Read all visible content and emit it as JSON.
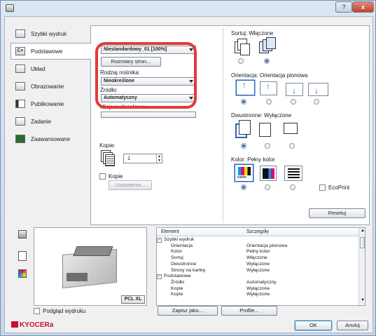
{
  "titlebar": {
    "help": "?",
    "close": "x"
  },
  "nav": [
    {
      "label": "Szybki wydruk",
      "icon": "quick-print-icon"
    },
    {
      "label": "Podstawowe",
      "icon": "basic-icon",
      "glyph": "C+"
    },
    {
      "label": "Układ",
      "icon": "layout-icon"
    },
    {
      "label": "Obrazowanie",
      "icon": "imaging-icon"
    },
    {
      "label": "Publikowanie",
      "icon": "publishing-icon"
    },
    {
      "label": "Zadanie",
      "icon": "job-icon"
    },
    {
      "label": "Zaawansowane",
      "icon": "advanced-icon"
    }
  ],
  "basic": {
    "page_size_value": "Niestandardowy_01 [100%]",
    "page_sizes_button": "Rozmiary stron...",
    "media_type_label": "Rodzaj nośnika:",
    "media_type_value": "Nieokreślone",
    "source_label": "Źródło:",
    "source_value": "Automatyczny",
    "destination_label": "Miejsce docelowe:",
    "copies_label": "Kopie:",
    "copies_value": "1",
    "collate_label": "Kopie",
    "settings_button": "Ustawienia..."
  },
  "right": {
    "collate_label": "Sortuj: Włączone",
    "orientation_label": "Orientacja: Orientacja pionowa",
    "duplex_label": "Dwustronne: Wyłączone",
    "color_label": "Kolor: Pełny kolor",
    "cmyk_text": "CMYK",
    "ecoprint_label": "EcoPrint",
    "reset_button": "Resetuj"
  },
  "preview": {
    "pcl_badge": "PCL XL",
    "preview_checkbox": "Podgląd wydruku"
  },
  "summary": {
    "col_element": "Element",
    "col_details": "Szczegóły",
    "rows": [
      {
        "name": "Szybki wydruk",
        "value": "",
        "group": true
      },
      {
        "name": "Orientacja",
        "value": "Orientacja pionowa",
        "group": false
      },
      {
        "name": "Kolor",
        "value": "Pełny kolor",
        "group": false
      },
      {
        "name": "Sortuj",
        "value": "Włączone",
        "group": false
      },
      {
        "name": "Dwustronne",
        "value": "Wyłączone",
        "group": false
      },
      {
        "name": "Strony na kartkę",
        "value": "Wyłączone",
        "group": false
      },
      {
        "name": "Podstawowe",
        "value": "",
        "group": true
      },
      {
        "name": "Źródło",
        "value": "Automatyczny",
        "group": false
      },
      {
        "name": "Kopie",
        "value": "Wyłączone",
        "group": false
      },
      {
        "name": "Kopie",
        "value": "Wyłączone",
        "group": false
      }
    ]
  },
  "buttons": {
    "save_as": "Zapisz jako...",
    "profile": "Profile...",
    "ok": "OK",
    "cancel": "Anuluj"
  },
  "brand": {
    "logo_text": "KYOCERa",
    "color": "#c8102e"
  },
  "colors": {
    "selection_blue": "#2b5fb4",
    "highlight_red": "#e23a3a"
  }
}
